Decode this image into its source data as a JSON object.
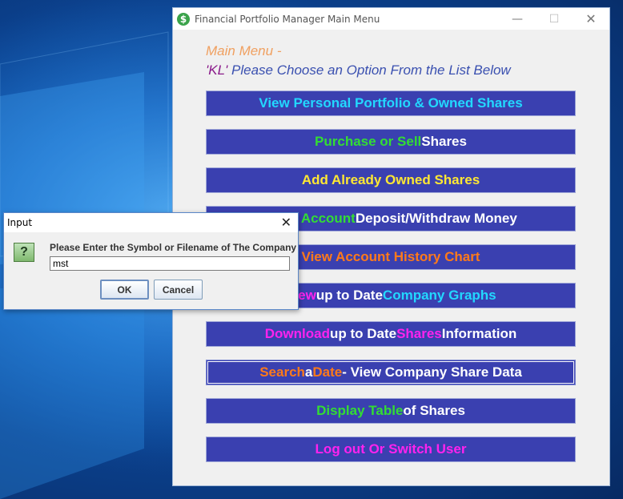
{
  "main_window": {
    "title": "Financial Portfolio Manager Main Menu",
    "app_icon_glyph": "$",
    "heading": "Main Menu -",
    "user": "'KL'",
    "prompt": " Please Choose an Option From the List Below",
    "buttons": [
      {
        "parts": [
          {
            "text": "View Personal Portfolio & Owned Shares",
            "color": "cyan"
          }
        ]
      },
      {
        "parts": [
          {
            "text": "Purchase or Sell",
            "color": "green"
          },
          {
            "text": " Shares",
            "color": "white"
          }
        ]
      },
      {
        "parts": [
          {
            "text": "Add Already Owned Shares",
            "color": "yellow"
          }
        ]
      },
      {
        "parts": [
          {
            "text": "Bank Account",
            "color": "green"
          },
          {
            "text": " Deposit/Withdraw Money",
            "color": "white"
          }
        ]
      },
      {
        "parts": [
          {
            "text": "View Account History Chart",
            "color": "orange"
          }
        ]
      },
      {
        "parts": [
          {
            "text": "View",
            "color": "magenta"
          },
          {
            "text": " up to Date ",
            "color": "white"
          },
          {
            "text": "Company Graphs",
            "color": "cyan"
          }
        ]
      },
      {
        "parts": [
          {
            "text": "Download",
            "color": "magenta"
          },
          {
            "text": " up to Date ",
            "color": "white"
          },
          {
            "text": "Shares",
            "color": "magenta"
          },
          {
            "text": " Information",
            "color": "white"
          }
        ]
      },
      {
        "parts": [
          {
            "text": "Search",
            "color": "orange"
          },
          {
            "text": " a ",
            "color": "white"
          },
          {
            "text": "Date",
            "color": "orange"
          },
          {
            "text": " - View Company Share Data",
            "color": "white"
          }
        ]
      },
      {
        "parts": [
          {
            "text": "Display Table",
            "color": "green"
          },
          {
            "text": " of Shares",
            "color": "white"
          }
        ]
      },
      {
        "parts": [
          {
            "text": "Log out Or Switch User",
            "color": "magenta"
          }
        ]
      }
    ]
  },
  "dialog": {
    "title": "Input",
    "icon_glyph": "?",
    "message": "Please Enter the Symbol or Filename of The Company",
    "input_value": "mst",
    "ok_label": "OK",
    "cancel_label": "Cancel"
  }
}
